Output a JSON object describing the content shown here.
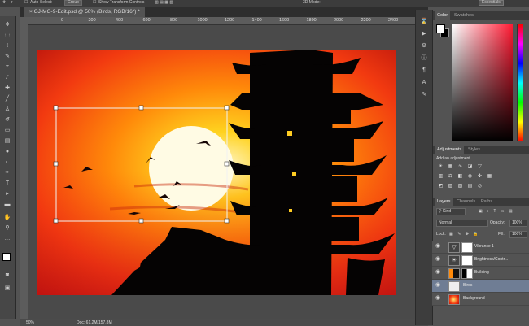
{
  "options_bar": {
    "auto_select_label": "Auto-Select:",
    "auto_select_value": "Group",
    "show_transform_label": "Show Transform Controls",
    "mode_3d_label": "3D Mode:",
    "workspace_value": "Essentials"
  },
  "document": {
    "tab_title": "GJ-MG-9-Edit.psd @ 50% (Birds, RGB/16*) *",
    "close_glyph": "×"
  },
  "ruler": {
    "ticks": [
      "0",
      "200",
      "400",
      "600",
      "800",
      "1000",
      "1200",
      "1400",
      "1600",
      "1800",
      "2000",
      "2200",
      "2400",
      "2600"
    ]
  },
  "status": {
    "zoom": "50%",
    "doc_info": "Doc: 61.2M/157.8M"
  },
  "tools": [
    "move",
    "marquee",
    "lasso",
    "quick-select",
    "crop",
    "eyedropper",
    "spot-heal",
    "brush",
    "clone",
    "history-brush",
    "eraser",
    "gradient",
    "blur",
    "dodge",
    "pen",
    "type",
    "path-select",
    "shape",
    "hand",
    "zoom",
    "more",
    "fg-bg",
    "quick-mask",
    "screen-mode"
  ],
  "panels": {
    "color_tabs": [
      "Color",
      "Swatches"
    ],
    "adjust_tabs": [
      "Adjustments",
      "Styles"
    ],
    "add_adjustment": "Add an adjustment",
    "layer_tabs": [
      "Layers",
      "Channels",
      "Paths"
    ],
    "filter_kind": "Kind",
    "blend_mode": "Normal",
    "opacity_label": "Opacity:",
    "opacity_value": "100%",
    "lock_label": "Lock:",
    "fill_label": "Fill:",
    "fill_value": "100%"
  },
  "layers": [
    {
      "name": "Vibrance 1",
      "selected": false
    },
    {
      "name": "Brightness/Contr...",
      "selected": false
    },
    {
      "name": "Building",
      "selected": false
    },
    {
      "name": "Birds",
      "selected": true
    },
    {
      "name": "Background",
      "selected": false
    }
  ],
  "colors": {
    "panel_bg": "#535353",
    "selected_layer": "#6f7d94",
    "accent": "#ff1a33"
  }
}
